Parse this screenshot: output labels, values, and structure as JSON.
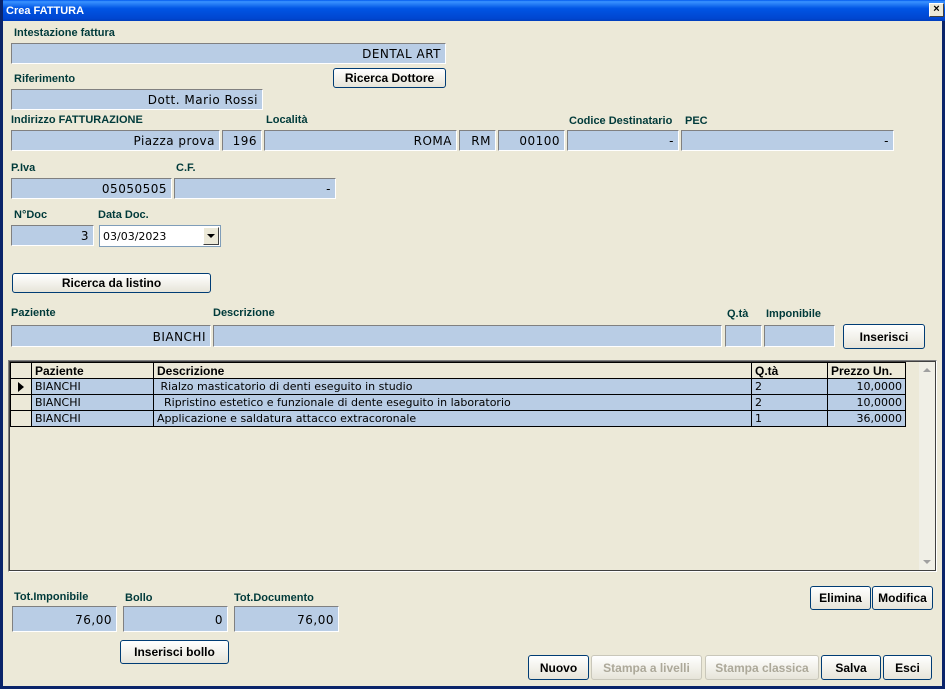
{
  "window": {
    "title": "Crea FATTURA",
    "close_label": "×"
  },
  "intestazione": {
    "label": "Intestazione fattura",
    "value": "DENTAL ART"
  },
  "riferimento": {
    "label": "Riferimento",
    "value": "Dott. Mario Rossi",
    "search_button": "Ricerca Dottore"
  },
  "indirizzo": {
    "label": "Indirizzo FATTURAZIONE",
    "street": "Piazza prova",
    "number": "196",
    "localita_label": "Località",
    "localita": "ROMA",
    "provincia": "RM",
    "cap": "00100",
    "codice_dest_label": "Codice Destinatario",
    "codice_dest": "-",
    "pec_label": "PEC",
    "pec": "-"
  },
  "fiscale": {
    "piva_label": "P.Iva",
    "piva": "05050505",
    "cf_label": "C.F.",
    "cf": "-"
  },
  "documento": {
    "ndoc_label": "N°Doc",
    "ndoc": "3",
    "data_label": "Data Doc.",
    "data": "03/03/2023"
  },
  "listino_button": "Ricerca da listino",
  "entry": {
    "paziente_label": "Paziente",
    "paziente": "BIANCHI",
    "descrizione_label": "Descrizione",
    "descrizione": "",
    "qta_label": "Q.tà",
    "qta": "",
    "imponibile_label": "Imponibile",
    "imponibile": "",
    "insert_button": "Inserisci"
  },
  "grid": {
    "columns": [
      "Paziente",
      "Descrizione",
      "Q.tà",
      "Prezzo Un."
    ],
    "rows": [
      {
        "paziente": "BIANCHI",
        "descrizione": " Rialzo masticatorio di denti eseguito in studio",
        "qta": "2",
        "prezzo": "10,0000"
      },
      {
        "paziente": "BIANCHI",
        "descrizione": "  Ripristino estetico e funzionale di dente eseguito in laboratorio",
        "qta": "2",
        "prezzo": "10,0000"
      },
      {
        "paziente": "BIANCHI",
        "descrizione": "Applicazione e saldatura attacco extracoronale",
        "qta": "1",
        "prezzo": "36,0000"
      }
    ]
  },
  "totals": {
    "imponibile_label": "Tot.Imponibile",
    "imponibile": "76,00",
    "bollo_label": "Bollo",
    "bollo": "0",
    "documento_label": "Tot.Documento",
    "documento": "76,00",
    "bollo_button": "Inserisci bollo"
  },
  "actions": {
    "elimina": "Elimina",
    "modifica": "Modifica",
    "nuovo": "Nuovo",
    "stampa_livelli": "Stampa a livelli",
    "stampa_classica": "Stampa classica",
    "salva": "Salva",
    "esci": "Esci"
  },
  "colors": {
    "field_bg": "#b9cde5",
    "window_bg": "#ece9d8",
    "title_bg": "#0055e5",
    "label_color": "#003a3a"
  }
}
